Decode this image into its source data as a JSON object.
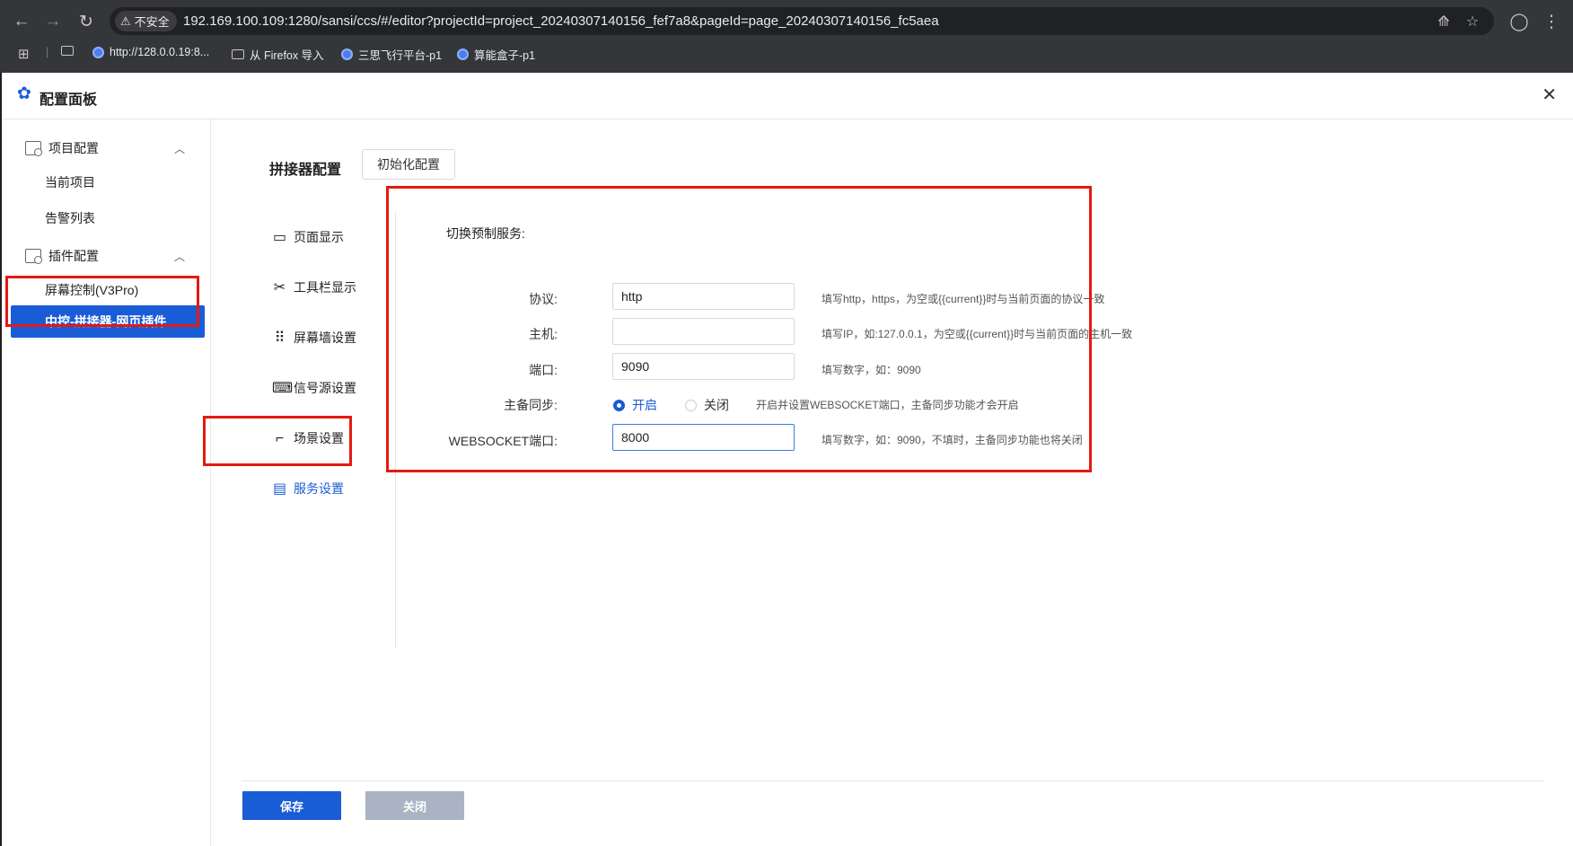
{
  "browser": {
    "insecure_label": "不安全",
    "url": "192.169.100.109:1280/sansi/ccs/#/editor?projectId=project_20240307140156_fef7a8&pageId=page_20240307140156_fc5aea",
    "bookmarks": [
      {
        "label": "http://128.0.0.19:8..."
      },
      {
        "label": "从 Firefox 导入"
      },
      {
        "label": "三思飞行平台-p1"
      },
      {
        "label": "算能盒子-p1"
      }
    ]
  },
  "dialog": {
    "title": "配置面板"
  },
  "sidebar": {
    "groups": [
      {
        "label": "项目配置",
        "items": [
          "当前项目",
          "告警列表"
        ]
      },
      {
        "label": "插件配置",
        "items": [
          "屏幕控制(V3Pro)",
          "中控-拼接器-网页插件"
        ]
      }
    ],
    "active_item": "中控-拼接器-网页插件"
  },
  "main": {
    "section_title": "拼接器配置",
    "init_button": "初始化配置",
    "tabs": [
      {
        "label": "页面显示",
        "icon": "monitor-icon"
      },
      {
        "label": "工具栏显示",
        "icon": "tools-icon"
      },
      {
        "label": "屏幕墙设置",
        "icon": "grid-dots-icon"
      },
      {
        "label": "信号源设置",
        "icon": "keyboard-icon"
      },
      {
        "label": "场景设置",
        "icon": "clapper-icon"
      },
      {
        "label": "服务设置",
        "icon": "server-icon"
      }
    ],
    "active_tab": "服务设置"
  },
  "form": {
    "heading": "切换预制服务:",
    "protocol": {
      "label": "协议:",
      "value": "http",
      "hint": "填写http，https，为空或{{current}}时与当前页面的协议一致"
    },
    "host": {
      "label": "主机:",
      "value": "",
      "hint": "填写IP，如:127.0.0.1，为空或{{current}}时与当前页面的主机一致"
    },
    "port": {
      "label": "端口:",
      "value": "9090",
      "hint": "填写数字，如：9090"
    },
    "sync": {
      "label": "主备同步:",
      "on_label": "开启",
      "off_label": "关闭",
      "selected": "开启",
      "hint": "开启并设置WEBSOCKET端口，主备同步功能才会开启"
    },
    "websocket": {
      "label": "WEBSOCKET端口:",
      "value": "8000",
      "hint": "填写数字，如：9090，不填时，主备同步功能也将关闭"
    }
  },
  "footer": {
    "save_label": "保存",
    "close_label": "关闭"
  },
  "colors": {
    "accent": "#1a5cd6",
    "highlight": "#e21a12"
  }
}
